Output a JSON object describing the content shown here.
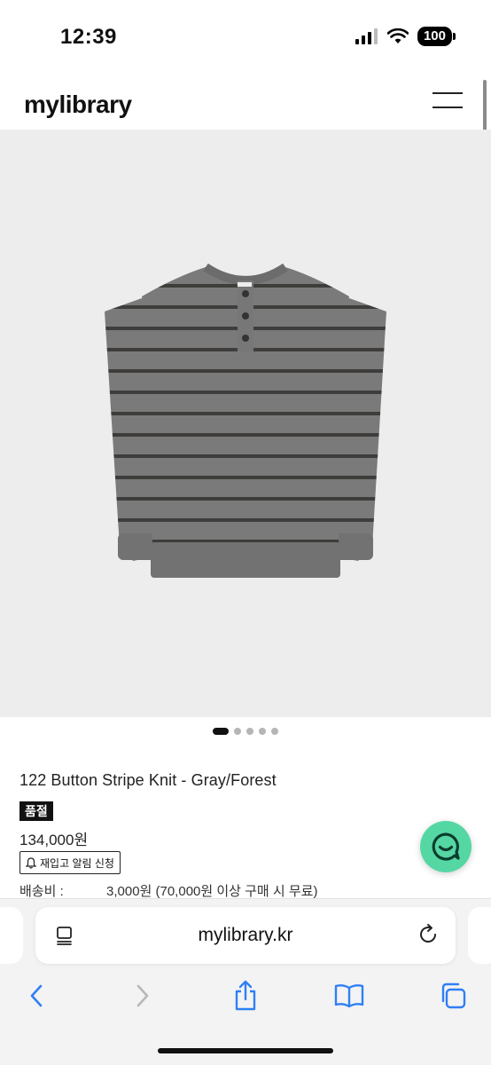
{
  "status": {
    "time": "12:39",
    "battery": "100"
  },
  "site": {
    "logo": "mylibrary"
  },
  "product": {
    "title": "122 Button Stripe Knit - Gray/Forest",
    "badge": "품절",
    "price": "134,000원",
    "restock_button": "재입고 알림 신청",
    "shipping_label": "배송비 :",
    "shipping_value": "3,000원 (70,000원 이상 구매 시 무료)",
    "image_count": 5,
    "active_image": 1
  },
  "browser": {
    "url": "mylibrary.kr"
  },
  "colors": {
    "accent_chat": "#55d7a4",
    "toolbar_icon": "#2f7ff5",
    "image_bg": "#ededed"
  }
}
